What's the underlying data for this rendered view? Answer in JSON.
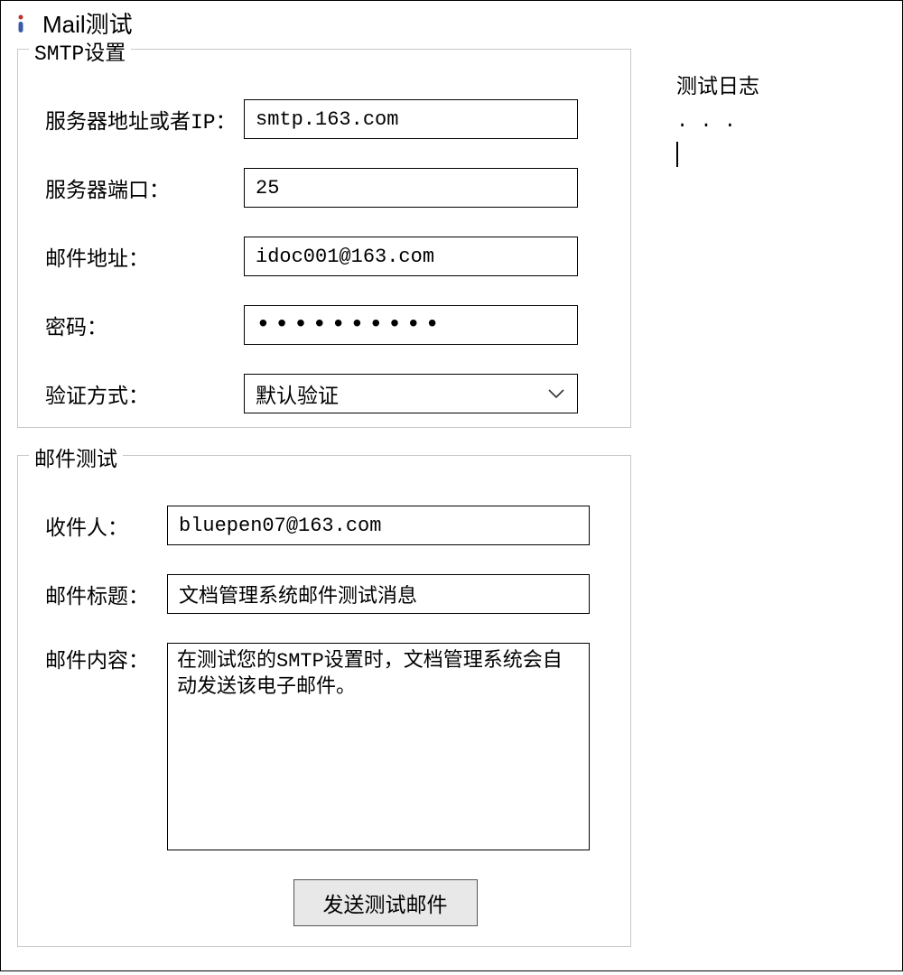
{
  "window": {
    "title": "Mail测试",
    "icon": "info-icon"
  },
  "smtp": {
    "legend": "SMTP设置",
    "server_label": "服务器地址或者IP：",
    "server_value": "smtp.163.com",
    "port_label": "服务器端口：",
    "port_value": "25",
    "email_label": "邮件地址：",
    "email_value": "idoc001@163.com",
    "password_label": "密码：",
    "password_value": "●●●●●●●●●●",
    "auth_label": "验证方式：",
    "auth_value": "默认验证"
  },
  "mailtest": {
    "legend": "邮件测试",
    "recipient_label": "收件人：",
    "recipient_value": "bluepen07@163.com",
    "subject_label": "邮件标题：",
    "subject_value": "文档管理系统邮件测试消息",
    "body_label": "邮件内容：",
    "body_value": "在测试您的SMTP设置时，文档管理系统会自动发送该电子邮件。",
    "send_button": "发送测试邮件"
  },
  "log": {
    "title": "测试日志",
    "content": ". . ."
  }
}
